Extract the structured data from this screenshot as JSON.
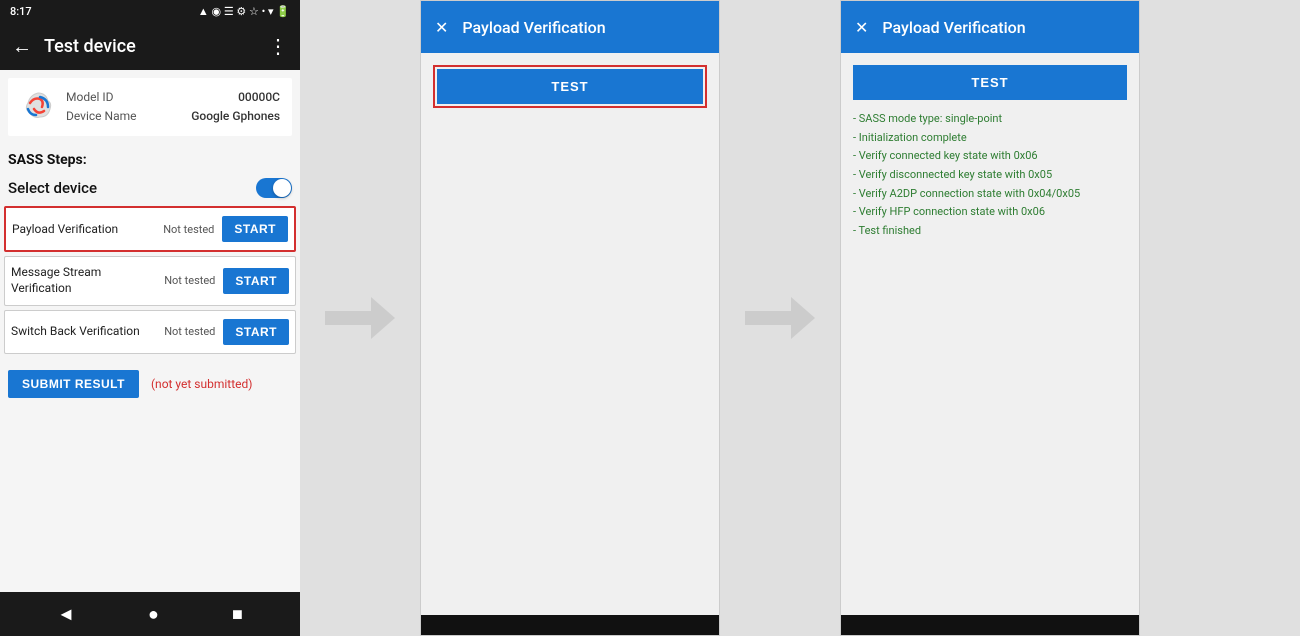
{
  "phone": {
    "status_bar": {
      "time": "8:17",
      "icons_right": "▲ ◉ ☁ ⚙ ☆ • ▾ 🔋"
    },
    "app_bar": {
      "back_icon": "←",
      "title": "Test device",
      "menu_icon": "⋮"
    },
    "device_info": {
      "model_id_label": "Model ID",
      "model_id_value": "00000C",
      "device_name_label": "Device Name",
      "device_name_value": "Google Gphones"
    },
    "sass_steps_label": "SASS Steps:",
    "select_device_label": "Select device",
    "steps": [
      {
        "name": "Payload Verification",
        "status": "Not tested",
        "button_label": "START",
        "highlighted": true
      },
      {
        "name": "Message Stream Verification",
        "status": "Not tested",
        "button_label": "START",
        "highlighted": false
      },
      {
        "name": "Switch Back Verification",
        "status": "Not tested",
        "button_label": "START",
        "highlighted": false
      }
    ],
    "submit_button_label": "SUBMIT RESULT",
    "submit_status": "(not yet submitted)",
    "nav_bar": {
      "back_icon": "◄",
      "home_icon": "●",
      "recent_icon": "■"
    }
  },
  "dialog1": {
    "close_icon": "✕",
    "title": "Payload Verification",
    "test_button_label": "TEST",
    "has_red_border": true
  },
  "dialog2": {
    "close_icon": "✕",
    "title": "Payload Verification",
    "test_button_label": "TEST",
    "has_red_border": false,
    "result_lines": [
      "- SASS mode type: single-point",
      "- Initialization complete",
      "- Verify connected key state with 0x06",
      "- Verify disconnected key state with 0x05",
      "- Verify A2DP connection state with 0x04/0x05",
      "- Verify HFP connection state with 0x06",
      "- Test finished"
    ]
  }
}
